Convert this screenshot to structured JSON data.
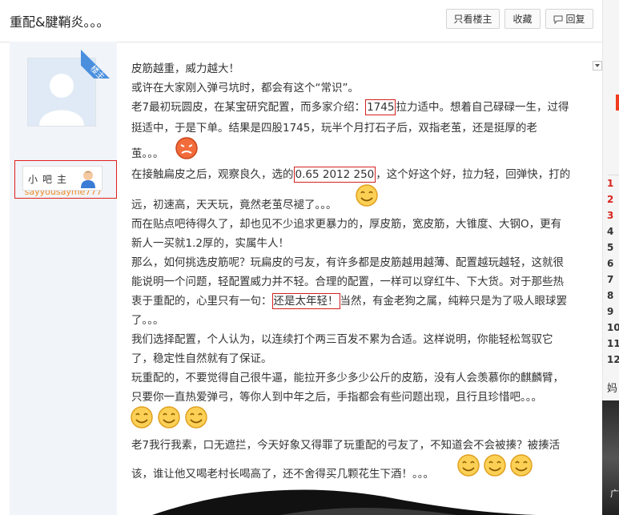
{
  "header": {
    "title": "重配&腱鞘炎。。。",
    "buttons": {
      "only_op": "只看楼主",
      "favorite": "收藏",
      "reply": "回复"
    }
  },
  "user": {
    "badge": "楼主",
    "name": "sayyousayme777",
    "role": "小吧主"
  },
  "post": {
    "lines": [
      "皮筋越重，威力越大！",
      "或许在大家刚入弹弓坑时，都会有这个“常识”。",
      [
        "老7最初玩圆皮，在某宝研究配置，而多家介绍：",
        "1745",
        "拉力适中。想着自己碌碌一生，过得"
      ],
      "挺适中，于是下单。结果是四股1745，玩半个月打石子后，双指老茧，还是挺厚的老",
      "茧。。。",
      [
        "在接触扁皮之后，观察良久，选的",
        "0.65 2012 250",
        "，这个好这个好，拉力轻，回弹快，打的"
      ],
      "远，初速高，天天玩，竟然老茧尽褪了。。。",
      "而在贴点吧待得久了，却也见不少追求更暴力的，厚皮筋，宽皮筋，大锥度、大钢O，更有",
      "新人一买就1.2厚的，实属牛人！",
      "那么，如何挑选皮筋呢？玩扁皮的弓友，有许多都是皮筋越用越薄、配置越玩越轻，这就很",
      "能说明一个问题，轻配置威力并不轻。合理的配置，一样可以穿红牛、下大货。对于那些热",
      [
        "衷于重配的，心里只有一句：",
        "还是太年轻！",
        "当然，有金老狗之属，纯粹只是为了吸人眼球罢"
      ],
      "了。。。",
      "我们选择配置，个人认为，以连续打个两三百发不累为合适。这样说明，你能轻松驾驭它",
      "了，稳定性自然就有了保证。",
      "玩重配的，不要觉得自己很牛逼，能拉开多少多少公斤的皮筋，没有人会羡慕你的麒麟臂，",
      "只要你一直热爱弹弓，等你人到中年之后，手指都会有些问题出现，且行且珍惜吧。。。",
      "老7我行我素，口无遮拦，今天好象又得罪了玩重配的弓友了，不知道会不会被揍？被揍活",
      "该，谁让他又喝老村长喝高了，还不舍得买几颗花生下酒！。。。"
    ]
  },
  "sidebar_right": {
    "ranks": [
      "1",
      "2",
      "3",
      "4",
      "5",
      "6",
      "7",
      "8",
      "9",
      "10",
      "11",
      "12"
    ],
    "char": "妈",
    "photo_caption": "广"
  },
  "colors": {
    "accent_red": "#d42020",
    "username": "#f08a24",
    "badge_blue": "#4a8fde"
  },
  "icons": [
    "reply-icon",
    "avatar-placeholder-icon",
    "user-role-icon",
    "smiley-icon",
    "angry-face-icon",
    "dropdown-arrow-icon"
  ]
}
